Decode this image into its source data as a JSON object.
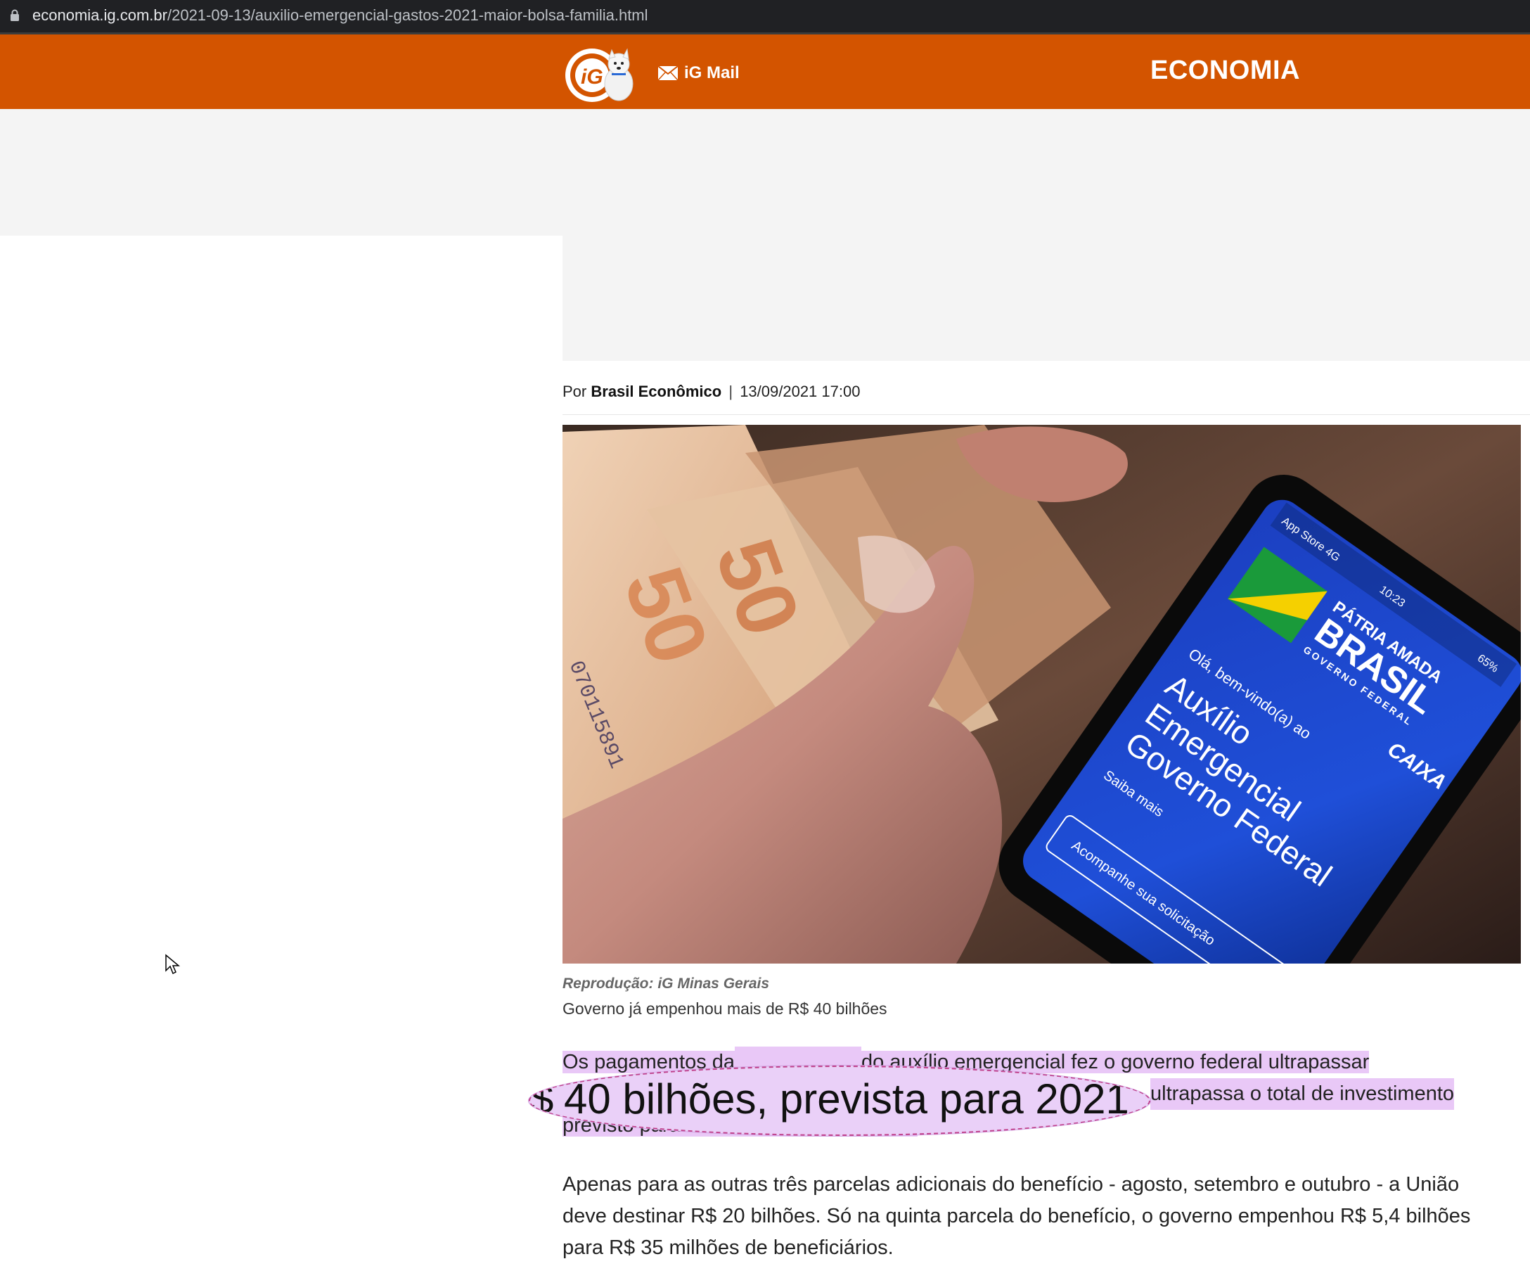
{
  "browser": {
    "url_host": "economia.ig.com.br",
    "url_path": "/2021-09-13/auxilio-emergencial-gastos-2021-maior-bolsa-familia.html"
  },
  "header": {
    "logo_icon": "ig-logo-dog",
    "mail_label": "iG Mail",
    "mail_icon": "envelope-icon",
    "section": "ECONOMIA",
    "brand_color": "#d35400"
  },
  "article": {
    "byline_prefix": "Por",
    "author": "Brasil Econômico",
    "byline_separator": "|",
    "datetime": "13/09/2021 17:00",
    "image_credit": "Reprodução: iG Minas Gerais",
    "image_caption": "Governo já empenhou mais de R$ 40 bilhões",
    "phone_screen": {
      "brand_line1": "PÁTRIA AMADA",
      "brand_line2": "BRASIL",
      "brand_line3": "GOVERNO FEDERAL",
      "bank": "CAIXA",
      "welcome": "Olá, bem-vindo(a) ao",
      "app_line1": "Auxílio",
      "app_line2": "Emergencial",
      "app_line3": "Governo Federal",
      "saiba": "Saiba mais",
      "acompanhe": "Acompanhe sua solicitação",
      "status_left": "App Store 4G",
      "status_time": "10:23",
      "status_right": "65%"
    },
    "banknote_value": "50",
    "banknote_serial": "070115891",
    "p1_line1": "Os pagamentos da",
    "p1_line1_end": "do auxílio emergencial fez o governo federal ultrapassar",
    "p1_line2_end": "ultrapassa o total de investimento",
    "p1_line3": "previsto para o Bolsa Família em 2021.",
    "zoom_edge": "$",
    "zoom_text": "40 bilhões, prevista para 2021",
    "p2": "Apenas para as outras três parcelas adicionais do benefício - agosto, setembro e outubro - a União deve destinar R$ 20 bilhões. Só na quinta parcela do benefício, o governo empenhou R$ 5,4 bilhões para R$ 35 milhões de beneficiários.",
    "highlight_color": "#e9c8f7"
  }
}
